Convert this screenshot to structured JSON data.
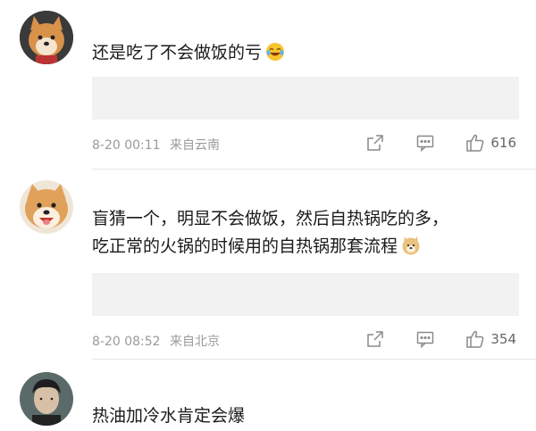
{
  "comments": [
    {
      "text": "还是吃了不会做饭的亏",
      "emoji": "laugh-cry-emoji",
      "date": "8-20 00:11",
      "source": "来自云南",
      "likes": "616"
    },
    {
      "text_line1": "盲猜一个，明显不会做饭，然后自热锅吃的多，",
      "text_line2": "吃正常的火锅的时候用的自热锅那套流程",
      "emoji": "doge-emoji",
      "date": "8-20 08:52",
      "source": "来自北京",
      "likes": "354"
    },
    {
      "text": "热油加冷水肯定会爆"
    }
  ],
  "colors": {
    "meta": "#9a9a9a",
    "placeholder": "#f2f2f2",
    "icon": "#8a8a8a"
  }
}
